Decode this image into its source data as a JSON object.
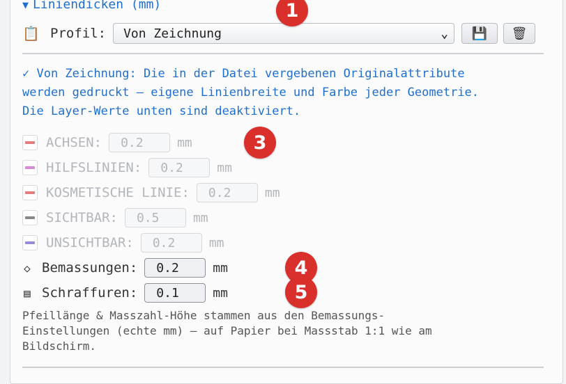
{
  "section": {
    "title": "Liniendicken (mm)",
    "toggle_icon": "triangle-down"
  },
  "profile": {
    "icon": "clipboard-icon",
    "label": "Profil:",
    "selected": "Von Zeichnung",
    "save_icon": "floppy-disk-icon",
    "delete_icon": "trash-icon"
  },
  "info_text": "✓ Von Zeichnung: Die in der Datei vergebenen Originalattribute\nwerden gedruckt – eigene Linienbreite und Farbe jeder Geometrie.\nDie Layer-Werte unten sind deaktiviert.",
  "layers": [
    {
      "label": "ACHSEN:",
      "value": "0.2",
      "unit": "mm",
      "color": "#e57c7c"
    },
    {
      "label": "HILFSLINIEN:",
      "value": "0.2",
      "unit": "mm",
      "color": "#d889d8"
    },
    {
      "label": "KOSMETISCHE LINIE:",
      "value": "0.2",
      "unit": "mm",
      "color": "#e57c7c"
    },
    {
      "label": "SICHTBAR:",
      "value": "0.5",
      "unit": "mm",
      "color": "#888888"
    },
    {
      "label": "UNSICHTBAR:",
      "value": "0.2",
      "unit": "mm",
      "color": "#9a8ad8"
    }
  ],
  "bemassungen": {
    "icon": "diamond-icon",
    "label": "Bemassungen:",
    "value": "0.2",
    "unit": "mm"
  },
  "schraffuren": {
    "icon": "hatch-icon",
    "label": "Schraffuren:",
    "value": "0.1",
    "unit": "mm"
  },
  "note_text": "Pfeillänge & Masszahl-Höhe stammen aus den Bemassungs-\nEinstellungen (echte mm) – auf Papier bei Massstab 1:1 wie am\nBildschirm.",
  "badges": [
    "1",
    "3",
    "4",
    "5"
  ],
  "colors": {
    "accent": "#1f6fd0",
    "badge": "#d9302c"
  }
}
